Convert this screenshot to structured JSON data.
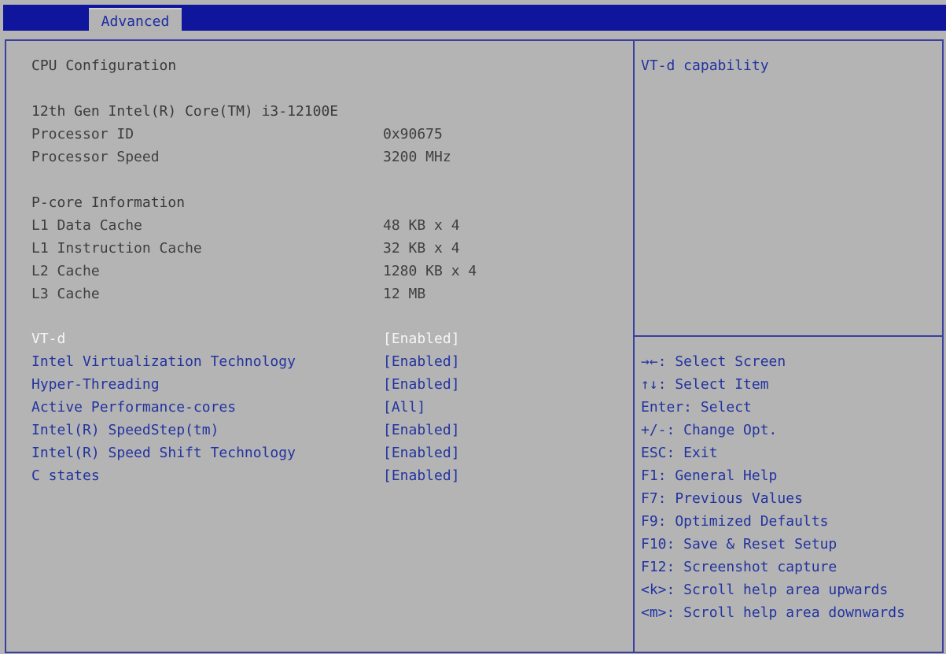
{
  "header": {
    "tab_label": "Advanced"
  },
  "main": {
    "section_title": "CPU Configuration",
    "cpu_name": "12th Gen Intel(R) Core(TM) i3-12100E",
    "info": [
      {
        "label": "Processor ID",
        "value": "0x90675"
      },
      {
        "label": "Processor Speed",
        "value": "3200 MHz"
      }
    ],
    "pcore_title": "P-core Information",
    "cache": [
      {
        "label": "L1 Data Cache",
        "value": "48 KB x 4"
      },
      {
        "label": "L1 Instruction Cache",
        "value": "32 KB x 4"
      },
      {
        "label": "L2 Cache",
        "value": "1280 KB x 4"
      },
      {
        "label": "L3 Cache",
        "value": "12 MB"
      }
    ],
    "settings": [
      {
        "label": "VT-d",
        "value": "[Enabled]",
        "selected": true
      },
      {
        "label": "Intel Virtualization Technology",
        "value": "[Enabled]"
      },
      {
        "label": "Hyper-Threading",
        "value": "[Enabled]"
      },
      {
        "label": "Active Performance-cores",
        "value": "[All]"
      },
      {
        "label": "Intel(R) SpeedStep(tm)",
        "value": "[Enabled]"
      },
      {
        "label": "Intel(R) Speed Shift Technology",
        "value": "[Enabled]"
      },
      {
        "label": "C states",
        "value": "[Enabled]"
      }
    ]
  },
  "help": {
    "title": "VT-d capability",
    "keys": [
      "→←: Select Screen",
      "↑↓: Select Item",
      "Enter: Select",
      "+/-: Change Opt.",
      "ESC: Exit",
      "F1: General Help",
      "F7: Previous Values",
      "F9: Optimized Defaults",
      "F10: Save & Reset Setup",
      "F12: Screenshot capture",
      "<k>: Scroll help area upwards",
      "<m>: Scroll help area downwards"
    ]
  },
  "colors": {
    "header_bar": "#0f169c",
    "background": "#b4b4b4",
    "setting_text": "#2233a0",
    "static_text": "#3f3f3f",
    "selected_text": "#f6f6f6"
  }
}
